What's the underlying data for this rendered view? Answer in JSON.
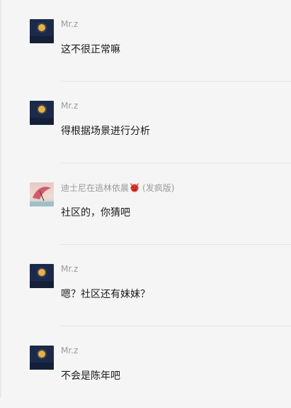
{
  "messages": [
    {
      "sender": "Mr.z",
      "avatar": "moon-night-avatar",
      "text": "这不很正常嘛"
    },
    {
      "sender": "Mr.z",
      "avatar": "moon-night-avatar",
      "text": "得根据场景进行分析"
    },
    {
      "sender": "迪士尼在逃林依晨",
      "sender_icon": "devil-emoji-icon",
      "tag": "(发疯版)",
      "avatar": "illustration-avatar",
      "text": "社区的，你猜吧"
    },
    {
      "sender": "Mr.z",
      "avatar": "moon-night-avatar",
      "text": "嗯？社区还有妹妹？"
    },
    {
      "sender": "Mr.z",
      "avatar": "moon-night-avatar",
      "text": "不会是陈年吧"
    }
  ],
  "colors": {
    "background": "#f5f5f5",
    "sender_text": "#9a9a9a",
    "message_text": "#1a1a1a",
    "moon_avatar_bg": "#1d2c4d",
    "moon": "#e8b04a"
  }
}
